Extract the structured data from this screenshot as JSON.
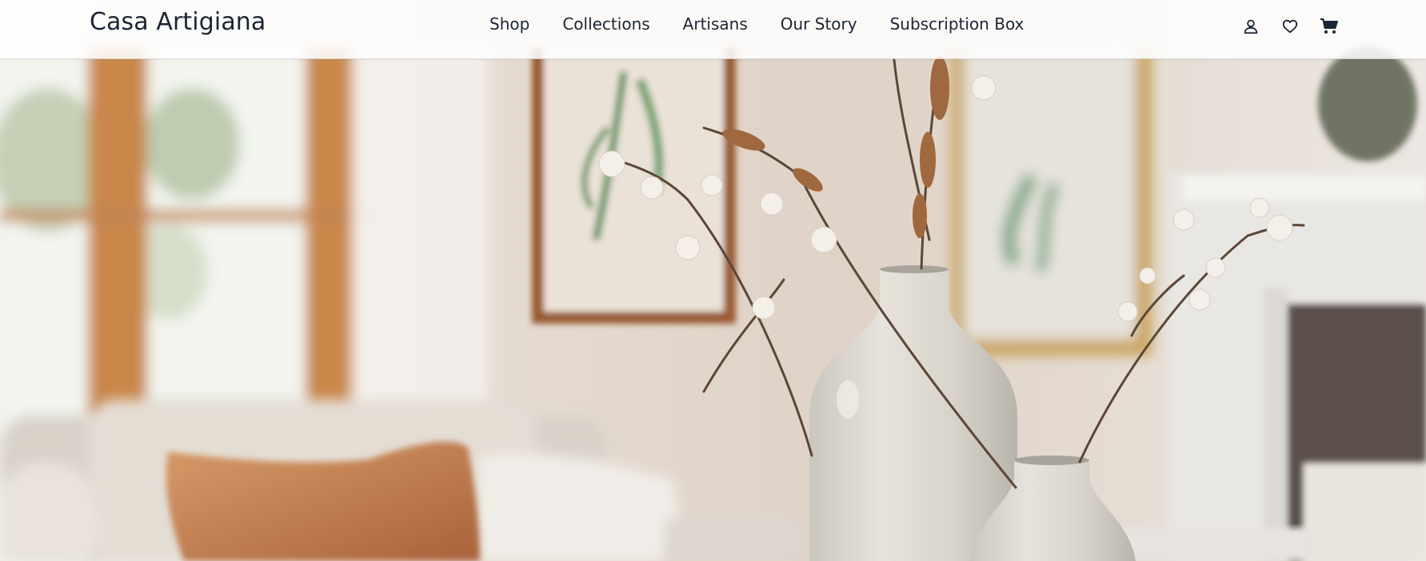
{
  "header": {
    "logo": "Casa Artigiana",
    "nav": [
      {
        "label": "Shop"
      },
      {
        "label": "Collections"
      },
      {
        "label": "Artisans"
      },
      {
        "label": "Our Story"
      },
      {
        "label": "Subscription Box"
      }
    ],
    "icons": [
      "user-icon",
      "heart-icon",
      "cart-icon"
    ]
  },
  "colors": {
    "text": "#1b2533",
    "header_bg": "#ffffff"
  }
}
